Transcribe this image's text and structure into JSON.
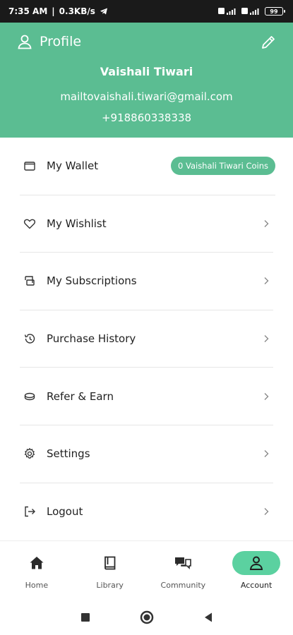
{
  "status_bar": {
    "time": "7:35 AM",
    "speed": "0.3KB/s",
    "battery": "99"
  },
  "header": {
    "title": "Profile",
    "name": "Vaishali Tiwari",
    "email": "mailtovaishali.tiwari@gmail.com",
    "phone": "+918860338338"
  },
  "menu": {
    "items": [
      {
        "label": "My Wallet",
        "icon": "wallet-icon",
        "badge": "0 Vaishali Tiwari Coins"
      },
      {
        "label": "My Wishlist",
        "icon": "heart-icon"
      },
      {
        "label": "My Subscriptions",
        "icon": "subscriptions-icon"
      },
      {
        "label": "Purchase History",
        "icon": "history-icon"
      },
      {
        "label": "Refer & Earn",
        "icon": "coins-icon"
      },
      {
        "label": "Settings",
        "icon": "gear-icon"
      },
      {
        "label": "Logout",
        "icon": "logout-icon"
      }
    ]
  },
  "bottom_nav": {
    "items": [
      {
        "label": "Home",
        "icon": "home-icon"
      },
      {
        "label": "Library",
        "icon": "book-icon"
      },
      {
        "label": "Community",
        "icon": "chat-icon"
      },
      {
        "label": "Account",
        "icon": "person-icon",
        "active": true
      }
    ]
  },
  "colors": {
    "accent": "#5bbd92",
    "active_pill": "#5bd1a0",
    "status_bar": "#1a1a1a"
  }
}
